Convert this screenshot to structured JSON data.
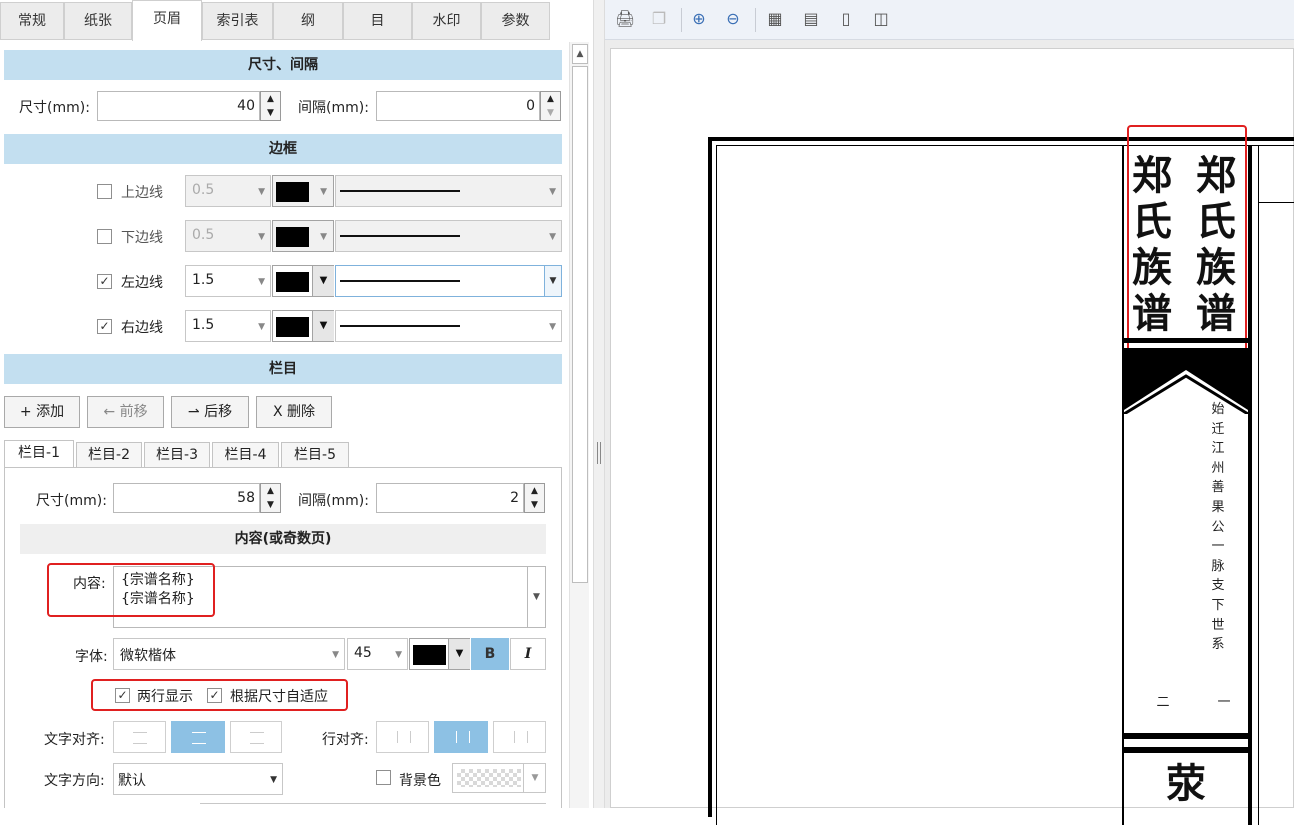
{
  "tabs": [
    {
      "label": "常规"
    },
    {
      "label": "纸张"
    },
    {
      "label": "页眉"
    },
    {
      "label": "索引表"
    },
    {
      "label": "纲"
    },
    {
      "label": "目"
    },
    {
      "label": "水印"
    },
    {
      "label": "参数"
    }
  ],
  "sections": {
    "size_spacing": "尺寸、间隔",
    "border": "边框",
    "columns": "栏目",
    "content": "内容(或奇数页)"
  },
  "header": {
    "size_label": "尺寸(mm):",
    "size_value": "40",
    "spacing_label": "间隔(mm):",
    "spacing_value": "0"
  },
  "borders": [
    {
      "label": "上边线",
      "checked": "",
      "width": "0.5",
      "enabled": false
    },
    {
      "label": "下边线",
      "checked": "",
      "width": "0.5",
      "enabled": false
    },
    {
      "label": "左边线",
      "checked": "✓",
      "width": "1.5",
      "enabled": true
    },
    {
      "label": "右边线",
      "checked": "✓",
      "width": "1.5",
      "enabled": true
    }
  ],
  "col_buttons": {
    "add": "+ 添加",
    "prev": "← 前移",
    "next": "⇀ 后移",
    "delete": "X 删除"
  },
  "col_tabs": [
    {
      "label": "栏目-1"
    },
    {
      "label": "栏目-2"
    },
    {
      "label": "栏目-3"
    },
    {
      "label": "栏目-4"
    },
    {
      "label": "栏目-5"
    }
  ],
  "column": {
    "size_label": "尺寸(mm):",
    "size_value": "58",
    "spacing_label": "间隔(mm):",
    "spacing_value": "2",
    "content_label": "内容:",
    "content_line1": "{宗谱名称}",
    "content_line2": "{宗谱名称}",
    "font_label": "字体:",
    "font_value": "微软楷体",
    "font_size": "45",
    "bold": "B",
    "italic": "I",
    "two_lines": "两行显示",
    "auto_fit": "根据尺寸自适应",
    "text_align_label": "文字对齐:",
    "line_align_label": "行对齐:",
    "direction_label": "文字方向:",
    "direction_value": "默认",
    "bg_label": "背景色"
  },
  "preview": {
    "title_col1": [
      "郑",
      "氏",
      "族",
      "谱"
    ],
    "title_col2": [
      "郑",
      "氏",
      "族",
      "谱"
    ],
    "subtitle": [
      "始",
      "迁",
      "江",
      "州",
      "善",
      "果",
      "公",
      "一",
      "脉",
      "支",
      "下",
      "世",
      "系"
    ],
    "page_left": "二",
    "page_right": "一",
    "bottom_char": "荥"
  },
  "colors": {
    "section_bg": "#c3dff0",
    "highlight": "#e02020",
    "selected_align": "#8dc1e4"
  }
}
